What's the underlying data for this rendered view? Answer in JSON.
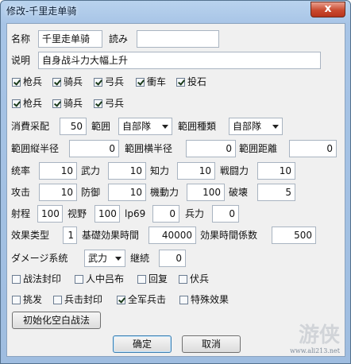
{
  "window": {
    "title": "修改-千里走单骑",
    "close": "x"
  },
  "row1": {
    "name_label": "名称",
    "name_value": "千里走单骑",
    "reading_label": "読み",
    "reading_value": ""
  },
  "row2": {
    "desc_label": "说明",
    "desc_value": "自身战斗力大幅上升"
  },
  "checks1": [
    {
      "label": "枪兵",
      "checked": true
    },
    {
      "label": "骑兵",
      "checked": true
    },
    {
      "label": "弓兵",
      "checked": true
    },
    {
      "label": "衝车",
      "checked": true
    },
    {
      "label": "投石",
      "checked": true
    }
  ],
  "checks2": [
    {
      "label": "枪兵",
      "checked": true
    },
    {
      "label": "骑兵",
      "checked": true
    },
    {
      "label": "弓兵",
      "checked": true
    }
  ],
  "row5": {
    "cost_label": "消費采配",
    "cost_value": "50",
    "range_label": "範囲",
    "range_value": "自部隊",
    "range_type_label": "範囲種類",
    "range_type_value": "自部隊"
  },
  "row6": {
    "v_radius_label": "範囲縦半径",
    "v_radius_value": "0",
    "h_radius_label": "範囲横半径",
    "h_radius_value": "0",
    "dist_label": "範囲距離",
    "dist_value": "0"
  },
  "row7": [
    {
      "label": "统率",
      "value": "10"
    },
    {
      "label": "武力",
      "value": "10"
    },
    {
      "label": "知力",
      "value": "10"
    },
    {
      "label": "戦闘力",
      "value": "10"
    }
  ],
  "row8": [
    {
      "label": "攻击",
      "value": "10"
    },
    {
      "label": "防御",
      "value": "10"
    },
    {
      "label": "機動力",
      "value": "100"
    },
    {
      "label": "破壊",
      "value": "5"
    }
  ],
  "row9": [
    {
      "label": "射程",
      "value": "100"
    },
    {
      "label": "视野",
      "value": "100"
    },
    {
      "label": "lp69",
      "value": "0"
    },
    {
      "label": "兵力",
      "value": "0"
    }
  ],
  "row10": {
    "effect_type_label": "效果类型",
    "effect_type_value": "1",
    "base_time_label": "基礎効果時間",
    "base_time_value": "40000",
    "time_coef_label": "効果時間係数",
    "time_coef_value": "500"
  },
  "row11": {
    "damage_label": "ダメージ系统",
    "damage_value": "武力",
    "continue_label": "継続",
    "continue_value": "0"
  },
  "checks3": [
    {
      "label": "战法封印",
      "checked": false
    },
    {
      "label": "人中吕布",
      "checked": false
    },
    {
      "label": "回复",
      "checked": false
    },
    {
      "label": "伏兵",
      "checked": false
    }
  ],
  "checks4": [
    {
      "label": "挑发",
      "checked": false
    },
    {
      "label": "兵击封印",
      "checked": false
    },
    {
      "label": "全军兵击",
      "checked": true
    },
    {
      "label": "特殊效果",
      "checked": false
    }
  ],
  "buttons": {
    "init": "初始化空白战法",
    "ok": "确定",
    "cancel": "取消"
  },
  "watermark": {
    "logo": "游侠",
    "url": "www.ali213.net"
  }
}
